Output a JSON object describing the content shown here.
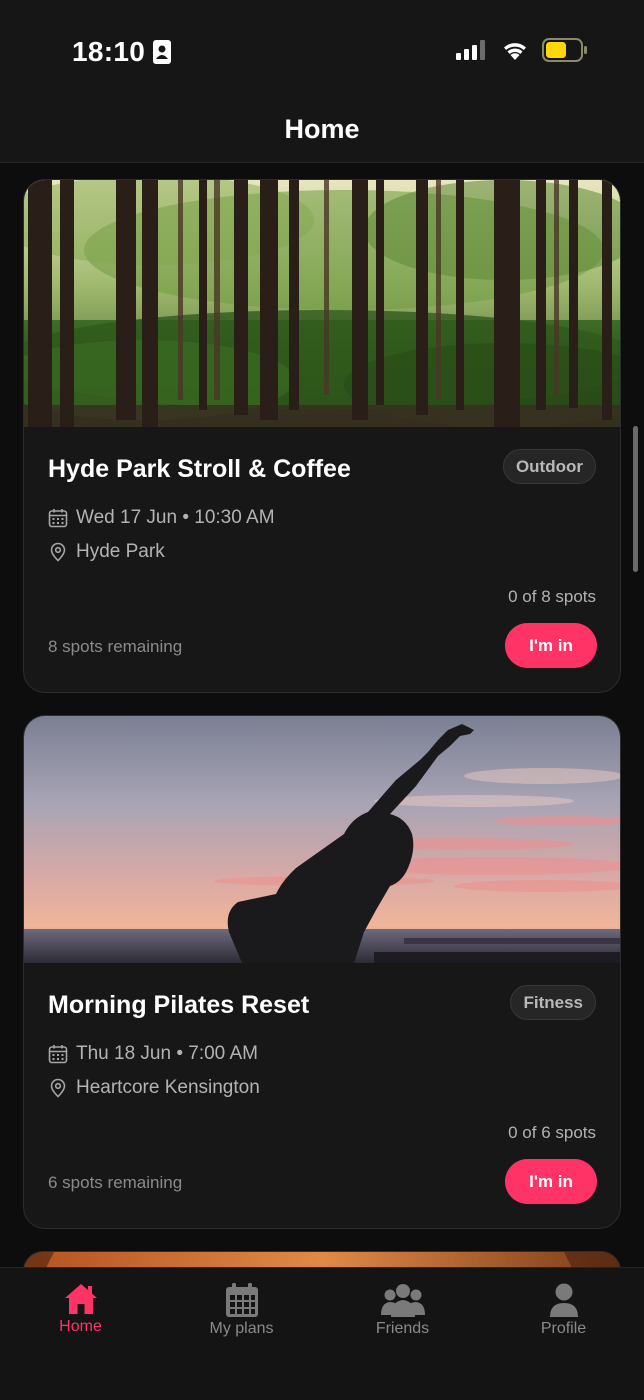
{
  "status_bar": {
    "time": "18:10"
  },
  "header": {
    "title": "Home"
  },
  "events": [
    {
      "title": "Hyde Park Stroll & Coffee",
      "tag": "Outdoor",
      "datetime": "Wed 17 Jun • 10:30 AM",
      "location": "Hyde Park",
      "spots_count": "0 of 8 spots",
      "spots_remaining": "8 spots remaining",
      "button_label": "I'm in"
    },
    {
      "title": "Morning Pilates Reset",
      "tag": "Fitness",
      "datetime": "Thu 18 Jun • 7:00 AM",
      "location": "Heartcore Kensington",
      "spots_count": "0 of 6 spots",
      "spots_remaining": "6 spots remaining",
      "button_label": "I'm in"
    }
  ],
  "tab_bar": {
    "tabs": [
      {
        "label": "Home",
        "icon": "home-icon",
        "active": true
      },
      {
        "label": "My plans",
        "icon": "calendar-icon",
        "active": false
      },
      {
        "label": "Friends",
        "icon": "friends-icon",
        "active": false
      },
      {
        "label": "Profile",
        "icon": "profile-icon",
        "active": false
      }
    ]
  },
  "colors": {
    "accent": "#ff3366",
    "background": "#0d0d0d",
    "card": "#171717",
    "battery": "#ffd60a"
  }
}
